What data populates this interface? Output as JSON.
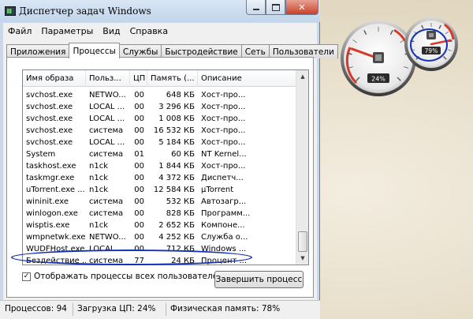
{
  "window": {
    "title": "Диспетчер задач Windows"
  },
  "menu": [
    "Файл",
    "Параметры",
    "Вид",
    "Справка"
  ],
  "tabs": [
    "Приложения",
    "Процессы",
    "Службы",
    "Быстродействие",
    "Сеть",
    "Пользователи"
  ],
  "active_tab": "Процессы",
  "columns": [
    "Имя образа",
    "Польз...",
    "ЦП",
    "Память (...",
    "Описание"
  ],
  "rows": [
    {
      "name": "svchost.exe",
      "user": "NETWO...",
      "cpu": "00",
      "mem": "648 КБ",
      "desc": "Хост-про..."
    },
    {
      "name": "svchost.exe",
      "user": "LOCAL ...",
      "cpu": "00",
      "mem": "3 296 КБ",
      "desc": "Хост-про..."
    },
    {
      "name": "svchost.exe",
      "user": "LOCAL ...",
      "cpu": "00",
      "mem": "1 008 КБ",
      "desc": "Хост-про..."
    },
    {
      "name": "svchost.exe",
      "user": "система",
      "cpu": "00",
      "mem": "16 532 КБ",
      "desc": "Хост-про..."
    },
    {
      "name": "svchost.exe",
      "user": "LOCAL ...",
      "cpu": "00",
      "mem": "5 184 КБ",
      "desc": "Хост-про..."
    },
    {
      "name": "System",
      "user": "система",
      "cpu": "01",
      "mem": "60 КБ",
      "desc": "NT Kernel..."
    },
    {
      "name": "taskhost.exe",
      "user": "n1ck",
      "cpu": "00",
      "mem": "1 844 КБ",
      "desc": "Хост-про..."
    },
    {
      "name": "taskmgr.exe",
      "user": "n1ck",
      "cpu": "00",
      "mem": "4 372 КБ",
      "desc": "Диспетч..."
    },
    {
      "name": "uTorrent.exe ...",
      "user": "n1ck",
      "cpu": "00",
      "mem": "12 584 КБ",
      "desc": "µTorrent"
    },
    {
      "name": "wininit.exe",
      "user": "система",
      "cpu": "00",
      "mem": "532 КБ",
      "desc": "Автозагр..."
    },
    {
      "name": "winlogon.exe",
      "user": "система",
      "cpu": "00",
      "mem": "828 КБ",
      "desc": "Программ..."
    },
    {
      "name": "wisptis.exe",
      "user": "n1ck",
      "cpu": "00",
      "mem": "2 652 КБ",
      "desc": "Компоне..."
    },
    {
      "name": "wmpnetwk.exe",
      "user": "NETWO...",
      "cpu": "00",
      "mem": "4 252 КБ",
      "desc": "Служба о..."
    },
    {
      "name": "WUDFHost.exe",
      "user": "LOCAL ...",
      "cpu": "00",
      "mem": "712 КБ",
      "desc": "Windows ..."
    },
    {
      "name": "Бездействие ...",
      "user": "система",
      "cpu": "77",
      "mem": "24 КБ",
      "desc": "Процент ..."
    }
  ],
  "show_all_users": {
    "label": "Отображать процессы всех пользователей",
    "checked": true,
    "mark": "✓"
  },
  "end_process_button": "Завершить процесс",
  "status": {
    "processes": "Процессов: 94",
    "cpu": "Загрузка ЦП: 24%",
    "memory": "Физическая память: 78%"
  },
  "gadget": {
    "cpu_percent": 24,
    "cpu_label": "24%",
    "mem_percent": 79,
    "mem_label": "79%"
  },
  "colors": {
    "annotation": "#1432b4",
    "window_frame": "#c9d9ea"
  }
}
